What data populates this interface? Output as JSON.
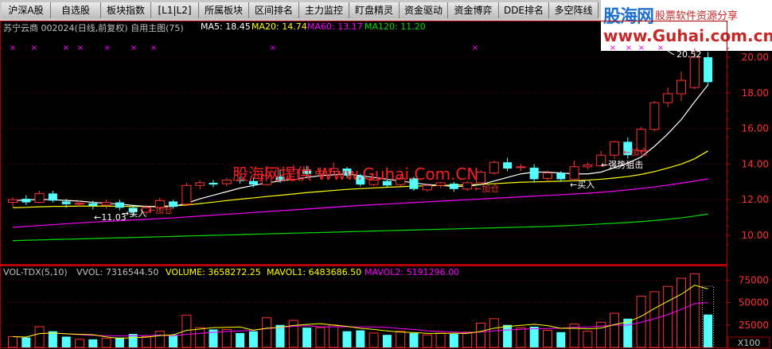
{
  "tabs": [
    {
      "label": "沪深A股"
    },
    {
      "label": "自选股"
    },
    {
      "label": "板块指数"
    },
    {
      "label": "[L1|L2]"
    },
    {
      "label": "所属板块"
    },
    {
      "label": "区间排名"
    },
    {
      "label": "主力监控"
    },
    {
      "label": "盯盘精灵"
    },
    {
      "label": "资金驱动"
    },
    {
      "label": "资金博弈"
    },
    {
      "label": "DDE排名"
    },
    {
      "label": "多空阵线"
    }
  ],
  "brand": {
    "name": "股海网",
    "slogan": "股票软件资源分享",
    "url": "www.Guhai.com.cn"
  },
  "price_header": {
    "stock": "苏宁云商 002024(日线,前复权) 自用主图(75)",
    "ma5": "MA5: 18.45",
    "ma20": "MA20: 14.74",
    "ma60": "MA60: 13.17",
    "ma120": "MA120: 11.20"
  },
  "volume_header": {
    "name": "VOL-TDX(5,10)",
    "vvol": "VVOL: 7316544.50",
    "volume": "VOLUME: 3658272.25",
    "mavol1": "MAVOL1: 6483686.50",
    "mavol2": "MAVOL2: 5191296.00"
  },
  "watermark": "股海网提供 Www.Guhai.Com.CN",
  "annotations": {
    "max_price": "20.52",
    "min_price": "11.03",
    "buy": "买入",
    "add": "加仓",
    "strong": "强势狙击"
  },
  "price_axis": {
    "ticks": [
      "20.00",
      "18.00",
      "16.00",
      "14.00",
      "12.00",
      "10.00"
    ]
  },
  "volume_axis": {
    "ticks": [
      "75000",
      "50000",
      "25000"
    ],
    "unit": "X100"
  },
  "colors": {
    "up": "#ff3232",
    "down": "#54ffff",
    "ma5": "#ffffff",
    "ma20": "#ffff00",
    "ma60": "#ff00ff",
    "ma120": "#00e000"
  },
  "chart_data": {
    "type": "candlestick",
    "ylim": [
      9.0,
      21.0
    ],
    "candles": [
      {
        "o": 11.85,
        "c": 12.0,
        "h": 12.15,
        "l": 11.6
      },
      {
        "o": 12.05,
        "c": 11.85,
        "h": 12.25,
        "l": 11.7
      },
      {
        "o": 11.85,
        "c": 12.35,
        "h": 12.5,
        "l": 11.8
      },
      {
        "o": 12.35,
        "c": 11.95,
        "h": 12.5,
        "l": 11.85
      },
      {
        "o": 11.9,
        "c": 11.75,
        "h": 12.05,
        "l": 11.55
      },
      {
        "o": 11.75,
        "c": 11.8,
        "h": 11.95,
        "l": 11.6
      },
      {
        "o": 11.8,
        "c": 11.65,
        "h": 11.95,
        "l": 11.45
      },
      {
        "o": 11.7,
        "c": 11.85,
        "h": 12.0,
        "l": 11.5
      },
      {
        "o": 11.85,
        "c": 11.55,
        "h": 12.0,
        "l": 11.4
      },
      {
        "o": 11.55,
        "c": 11.3,
        "h": 11.65,
        "l": 11.03
      },
      {
        "o": 11.3,
        "c": 11.55,
        "h": 11.7,
        "l": 11.15
      },
      {
        "o": 11.55,
        "c": 11.95,
        "h": 12.1,
        "l": 11.45
      },
      {
        "o": 11.9,
        "c": 11.6,
        "h": 12.0,
        "l": 11.5
      },
      {
        "o": 11.75,
        "c": 12.8,
        "h": 12.95,
        "l": 11.65
      },
      {
        "o": 12.8,
        "c": 12.95,
        "h": 13.1,
        "l": 12.6
      },
      {
        "o": 12.95,
        "c": 12.85,
        "h": 13.1,
        "l": 12.7
      },
      {
        "o": 12.9,
        "c": 13.1,
        "h": 13.25,
        "l": 12.75
      },
      {
        "o": 13.1,
        "c": 13.05,
        "h": 13.3,
        "l": 12.9
      },
      {
        "o": 13.05,
        "c": 12.85,
        "h": 13.25,
        "l": 12.7
      },
      {
        "o": 12.85,
        "c": 13.35,
        "h": 13.9,
        "l": 12.8
      },
      {
        "o": 13.3,
        "c": 13.1,
        "h": 13.7,
        "l": 12.95
      },
      {
        "o": 13.15,
        "c": 13.7,
        "h": 13.95,
        "l": 13.05
      },
      {
        "o": 13.7,
        "c": 13.45,
        "h": 13.9,
        "l": 13.3
      },
      {
        "o": 13.45,
        "c": 13.6,
        "h": 13.8,
        "l": 13.3
      },
      {
        "o": 13.6,
        "c": 13.75,
        "h": 14.1,
        "l": 13.5
      },
      {
        "o": 13.75,
        "c": 13.35,
        "h": 13.85,
        "l": 13.2
      },
      {
        "o": 13.35,
        "c": 12.85,
        "h": 13.45,
        "l": 12.75
      },
      {
        "o": 12.85,
        "c": 13.1,
        "h": 13.3,
        "l": 12.75
      },
      {
        "o": 13.05,
        "c": 12.8,
        "h": 13.3,
        "l": 12.7
      },
      {
        "o": 12.85,
        "c": 13.2,
        "h": 13.35,
        "l": 12.75
      },
      {
        "o": 13.2,
        "c": 12.6,
        "h": 13.3,
        "l": 12.5
      },
      {
        "o": 12.55,
        "c": 12.8,
        "h": 12.9,
        "l": 12.45
      },
      {
        "o": 12.8,
        "c": 12.95,
        "h": 13.0,
        "l": 12.65
      },
      {
        "o": 12.9,
        "c": 12.6,
        "h": 13.0,
        "l": 12.45
      },
      {
        "o": 12.6,
        "c": 12.95,
        "h": 13.05,
        "l": 12.5
      },
      {
        "o": 12.95,
        "c": 13.55,
        "h": 13.65,
        "l": 12.9
      },
      {
        "o": 13.5,
        "c": 14.1,
        "h": 14.2,
        "l": 13.4
      },
      {
        "o": 14.1,
        "c": 13.75,
        "h": 14.35,
        "l": 13.6
      },
      {
        "o": 13.8,
        "c": 13.85,
        "h": 14.0,
        "l": 13.6
      },
      {
        "o": 13.8,
        "c": 13.15,
        "h": 14.0,
        "l": 12.95
      },
      {
        "o": 13.2,
        "c": 13.5,
        "h": 13.65,
        "l": 12.95
      },
      {
        "o": 13.5,
        "c": 13.15,
        "h": 13.6,
        "l": 13.0
      },
      {
        "o": 13.15,
        "c": 13.85,
        "h": 14.2,
        "l": 13.1
      },
      {
        "o": 13.85,
        "c": 13.95,
        "h": 14.1,
        "l": 13.7
      },
      {
        "o": 13.9,
        "c": 14.5,
        "h": 14.75,
        "l": 13.85
      },
      {
        "o": 14.5,
        "c": 15.25,
        "h": 15.3,
        "l": 14.3
      },
      {
        "o": 15.25,
        "c": 14.5,
        "h": 15.5,
        "l": 14.3
      },
      {
        "o": 14.75,
        "c": 15.95,
        "h": 16.1,
        "l": 14.6
      },
      {
        "o": 15.95,
        "c": 17.45,
        "h": 17.55,
        "l": 15.85
      },
      {
        "o": 17.45,
        "c": 17.95,
        "h": 18.3,
        "l": 17.2
      },
      {
        "o": 17.95,
        "c": 18.7,
        "h": 19.2,
        "l": 17.55
      },
      {
        "o": 18.3,
        "c": 20.0,
        "h": 20.52,
        "l": 18.2
      },
      {
        "o": 20.0,
        "c": 18.6,
        "h": 20.3,
        "l": 18.4
      }
    ],
    "ma5": [
      11.95,
      11.98,
      12.02,
      12.0,
      11.96,
      11.92,
      11.85,
      11.8,
      11.75,
      11.68,
      11.62,
      11.6,
      11.62,
      11.8,
      12.05,
      12.25,
      12.45,
      12.65,
      12.8,
      12.95,
      13.05,
      13.15,
      13.25,
      13.35,
      13.4,
      13.45,
      13.35,
      13.25,
      13.15,
      13.05,
      12.95,
      12.85,
      12.8,
      12.75,
      12.75,
      12.85,
      13.05,
      13.25,
      13.45,
      13.55,
      13.55,
      13.5,
      13.45,
      13.45,
      13.55,
      13.8,
      14.05,
      14.4,
      15.0,
      15.7,
      16.5,
      17.5,
      18.45
    ],
    "ma20": [
      11.55,
      11.57,
      11.6,
      11.62,
      11.63,
      11.64,
      11.64,
      11.64,
      11.63,
      11.62,
      11.62,
      11.63,
      11.65,
      11.7,
      11.78,
      11.86,
      11.95,
      12.03,
      12.1,
      12.18,
      12.25,
      12.32,
      12.4,
      12.46,
      12.52,
      12.58,
      12.62,
      12.66,
      12.7,
      12.73,
      12.76,
      12.78,
      12.8,
      12.82,
      12.84,
      12.86,
      12.9,
      12.94,
      12.98,
      13.0,
      13.02,
      13.04,
      13.06,
      13.1,
      13.15,
      13.22,
      13.3,
      13.42,
      13.58,
      13.78,
      14.0,
      14.3,
      14.74
    ],
    "ma60": [
      10.45,
      10.5,
      10.55,
      10.6,
      10.65,
      10.7,
      10.74,
      10.78,
      10.82,
      10.86,
      10.9,
      10.94,
      10.98,
      11.03,
      11.08,
      11.13,
      11.18,
      11.23,
      11.28,
      11.33,
      11.38,
      11.43,
      11.48,
      11.53,
      11.58,
      11.63,
      11.68,
      11.72,
      11.76,
      11.8,
      11.84,
      11.88,
      11.92,
      11.96,
      12.0,
      12.04,
      12.08,
      12.12,
      12.16,
      12.2,
      12.24,
      12.28,
      12.32,
      12.36,
      12.42,
      12.48,
      12.55,
      12.63,
      12.72,
      12.82,
      12.93,
      13.05,
      13.17
    ],
    "ma120": [
      9.7,
      9.72,
      9.74,
      9.76,
      9.78,
      9.8,
      9.82,
      9.84,
      9.86,
      9.88,
      9.9,
      9.92,
      9.94,
      9.96,
      9.98,
      10.0,
      10.02,
      10.04,
      10.06,
      10.08,
      10.1,
      10.12,
      10.14,
      10.16,
      10.18,
      10.2,
      10.22,
      10.24,
      10.26,
      10.28,
      10.3,
      10.32,
      10.34,
      10.36,
      10.38,
      10.4,
      10.42,
      10.44,
      10.46,
      10.48,
      10.5,
      10.53,
      10.56,
      10.6,
      10.64,
      10.68,
      10.72,
      10.77,
      10.83,
      10.9,
      10.98,
      11.08,
      11.2
    ],
    "volume": [
      12000,
      11000,
      23000,
      18000,
      12000,
      9000,
      9000,
      10000,
      11000,
      15000,
      12000,
      18000,
      14000,
      36000,
      22000,
      20000,
      20000,
      16000,
      18000,
      33000,
      25000,
      30000,
      22000,
      22000,
      25000,
      18000,
      19000,
      16000,
      14000,
      18000,
      16000,
      14000,
      16000,
      15000,
      17000,
      27000,
      32000,
      25000,
      22000,
      23000,
      19000,
      17000,
      26000,
      18000,
      28000,
      38000,
      32000,
      57000,
      62000,
      68000,
      77000,
      82000,
      36580
    ]
  }
}
